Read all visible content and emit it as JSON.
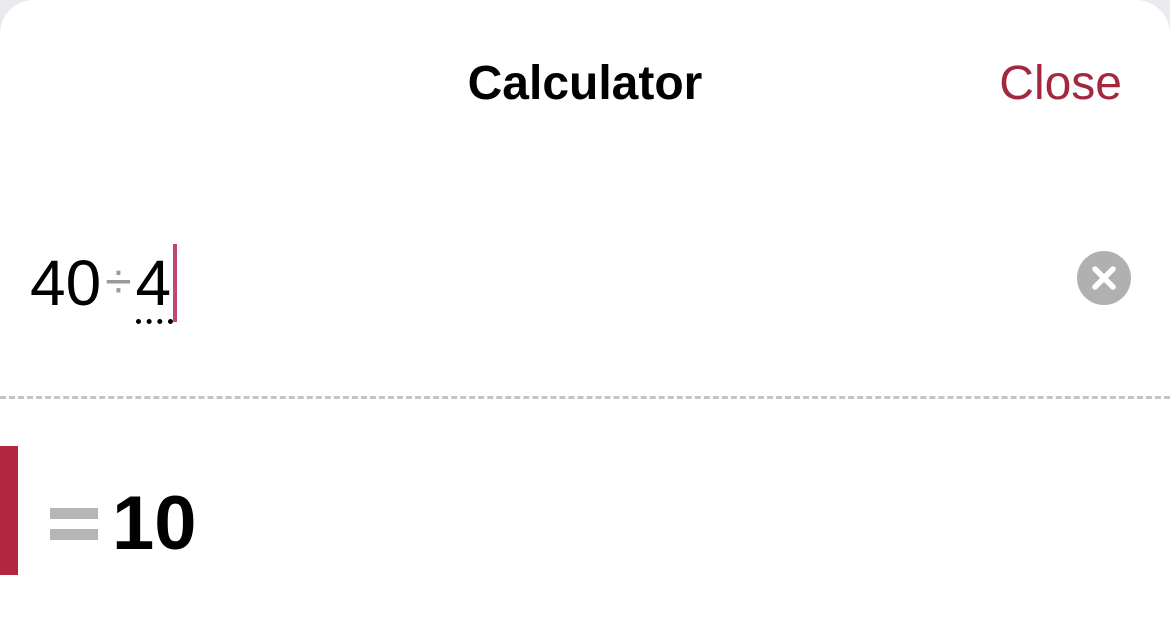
{
  "header": {
    "title": "Calculator",
    "close_label": "Close"
  },
  "expression": {
    "first_operand": "40",
    "operator": "÷",
    "second_operand": "4"
  },
  "result": {
    "equals_symbol": "=",
    "value": "10"
  },
  "colors": {
    "accent": "#a3283e",
    "result_bar": "#b3263f",
    "caret": "#c04a6a",
    "clear_button": "#b0b0b0"
  },
  "icons": {
    "clear": "clear-x-circle-icon"
  }
}
